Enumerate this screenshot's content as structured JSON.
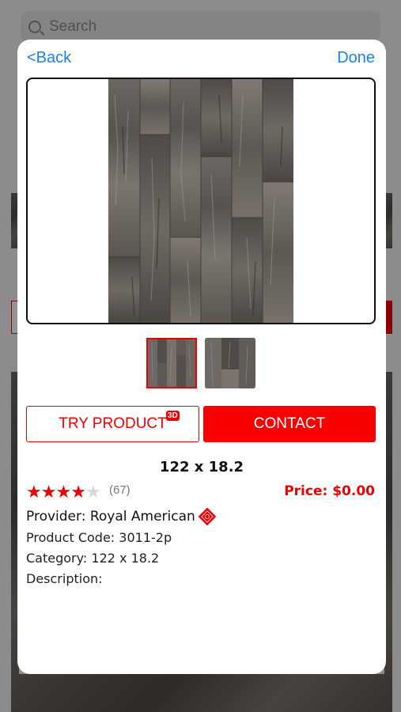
{
  "background": {
    "search_placeholder": "Search"
  },
  "nav": {
    "back_label": "<Back",
    "done_label": "Done"
  },
  "actions": {
    "try_label": "TRY PRODUCT",
    "try_badge": "3D",
    "contact_label": "CONTACT"
  },
  "product": {
    "size_title": "122 x 18.2",
    "rating_stars": 4,
    "rating_max": 5,
    "rating_count": "(67)",
    "price": "Price: $0.00",
    "provider": "Provider: Royal American",
    "product_code": "Product Code: 3011-2p",
    "category": "Category: 122 x 18.2",
    "description": "Description:"
  },
  "thumbnails": {
    "count": 2,
    "selected_index": 0
  },
  "colors": {
    "accent": "#fb0000",
    "link": "#1a82e8"
  },
  "icons": [
    "search-icon",
    "star-icon",
    "provider-logo-icon"
  ]
}
